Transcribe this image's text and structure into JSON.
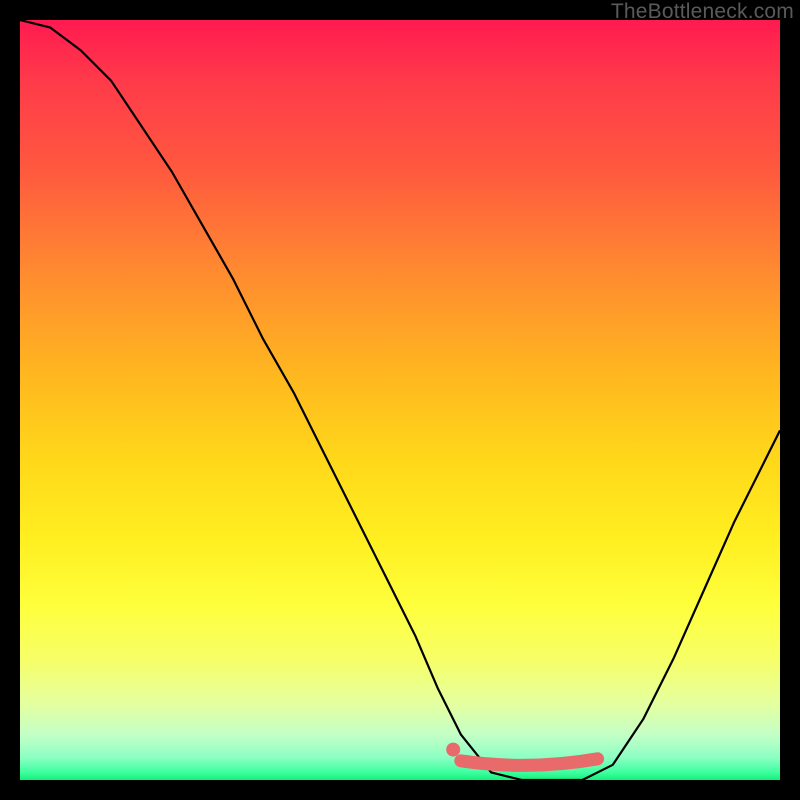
{
  "watermark": "TheBottleneck.com",
  "colors": {
    "frame": "#000000",
    "curve": "#000000",
    "marker": "#e86a6a",
    "gradient_top": "#ff1a50",
    "gradient_mid": "#ffd81a",
    "gradient_bottom": "#14f07a"
  },
  "chart_data": {
    "type": "line",
    "title": "",
    "xlabel": "",
    "ylabel": "",
    "xlim": [
      0,
      100
    ],
    "ylim": [
      0,
      100
    ],
    "grid": false,
    "legend": false,
    "series": [
      {
        "name": "bottleneck-curve",
        "x": [
          0,
          4,
          8,
          12,
          16,
          20,
          24,
          28,
          32,
          36,
          40,
          44,
          48,
          52,
          55,
          58,
          62,
          66,
          70,
          74,
          78,
          82,
          86,
          90,
          94,
          98,
          100
        ],
        "values": [
          100,
          99,
          96,
          92,
          86,
          80,
          73,
          66,
          58,
          51,
          43,
          35,
          27,
          19,
          12,
          6,
          1,
          0,
          0,
          0,
          2,
          8,
          16,
          25,
          34,
          42,
          46
        ]
      }
    ],
    "optimal_region": {
      "x_start": 58,
      "x_end": 76,
      "y": 2
    },
    "marker_point": {
      "x": 57,
      "y": 4
    }
  }
}
